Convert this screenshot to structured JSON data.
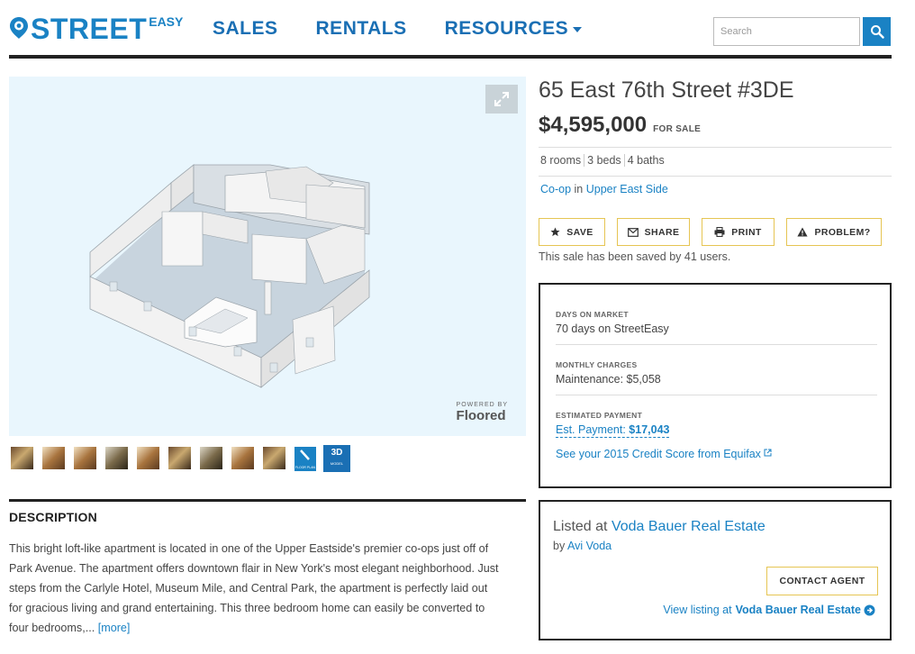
{
  "header": {
    "logo_main": "STREET",
    "logo_sup": "EASY",
    "nav": [
      {
        "label": "SALES"
      },
      {
        "label": "RENTALS"
      },
      {
        "label": "RESOURCES"
      }
    ],
    "search_placeholder": "Search"
  },
  "media": {
    "powered_by": "POWERED BY",
    "powered_brand": "Floored",
    "floor_plan_label": "FLOOR PLAN",
    "model_label": "3D",
    "model_sub": "MODEL"
  },
  "description": {
    "heading": "DESCRIPTION",
    "lines": [
      "This bright loft-like apartment is located in one of the Upper Eastside's premier co-ops just off of",
      "Park Avenue. The apartment offers downtown flair in New York's most elegant neighborhood. Just",
      "steps from the Carlyle Hotel, Museum Mile, and Central Park, the apartment is perfectly laid out",
      "for gracious living and grand entertaining. This three bedroom home can easily be converted to",
      "four bedrooms,..."
    ],
    "more_label": "[more]"
  },
  "listing": {
    "address": "65 East 76th Street #3DE",
    "price": "$4,595,000",
    "status": "FOR SALE",
    "details": [
      "8 rooms",
      "3 beds",
      "4 baths"
    ],
    "type": "Co-op",
    "in_word": "in",
    "neighborhood": "Upper East Side",
    "actions": [
      {
        "label": "SAVE",
        "icon": "star-icon"
      },
      {
        "label": "SHARE",
        "icon": "envelope-icon"
      },
      {
        "label": "PRINT",
        "icon": "printer-icon"
      },
      {
        "label": "PROBLEM?",
        "icon": "warning-icon"
      }
    ],
    "saved_text": "This sale has been saved by 41 users."
  },
  "stats": {
    "days_label": "DAYS ON MARKET",
    "days_value": "70 days on StreetEasy",
    "charges_label": "MONTHLY CHARGES",
    "charges_value": "Maintenance: $5,058",
    "payment_label": "ESTIMATED PAYMENT",
    "payment_prefix": "Est. Payment:",
    "payment_value": "$17,043",
    "credit_link": "See your 2015 Credit Score from Equifax"
  },
  "agent": {
    "listed_prefix": "Listed at",
    "brokerage": "Voda Bauer Real Estate",
    "by_prefix": "by",
    "agent_name": "Avi Voda",
    "contact_label": "CONTACT AGENT",
    "view_prefix": "View listing at",
    "view_brokerage": "Voda Bauer Real Estate"
  },
  "colors": {
    "brand_blue": "#1a82c4",
    "accent_yellow": "#e6c553",
    "media_bg": "#e9f6fd"
  }
}
